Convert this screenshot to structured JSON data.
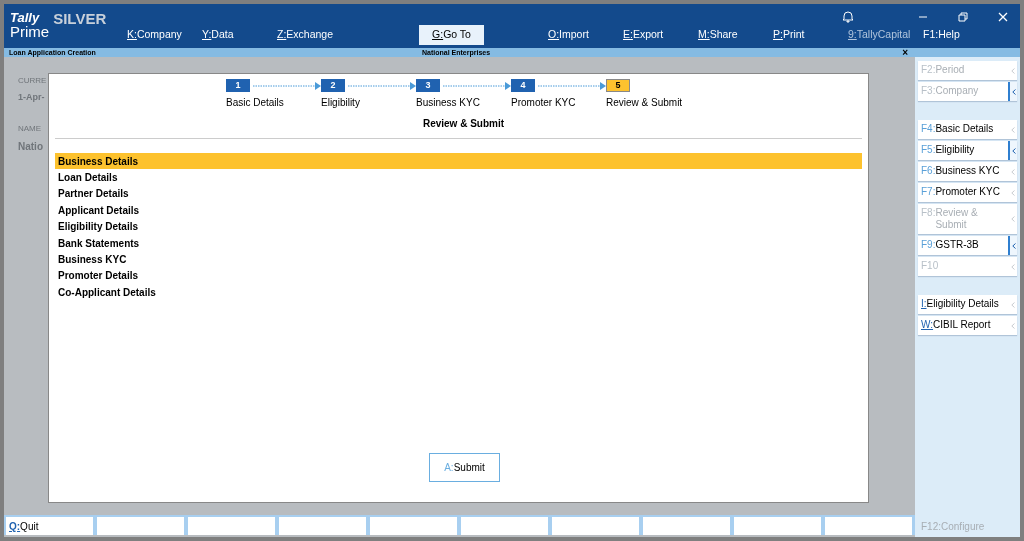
{
  "app": {
    "logo_top": "Tally",
    "logo_bottom": "Prime",
    "edition": "SILVER"
  },
  "top_menu": [
    {
      "key": "K:",
      "label": "Company",
      "selected": false
    },
    {
      "key": "Y:",
      "label": "Data",
      "selected": false
    },
    {
      "key": "Z:",
      "label": "Exchange",
      "selected": false
    },
    {
      "key": "G:",
      "label": "Go To",
      "selected": true
    },
    {
      "key": "O:",
      "label": "Import",
      "selected": false
    },
    {
      "key": "E:",
      "label": "Export",
      "selected": false
    },
    {
      "key": "M:",
      "label": "Share",
      "selected": false
    },
    {
      "key": "P:",
      "label": "Print",
      "selected": false
    },
    {
      "key": "9:",
      "label": "TallyCapital",
      "selected": false,
      "disabled": true
    },
    {
      "key": "F1:",
      "label": "Help",
      "selected": false
    }
  ],
  "subheader": {
    "title": "Loan Application Creation",
    "company": "National Enterprises",
    "close": "×"
  },
  "background_fields": [
    "CURRE",
    "1-Apr-",
    "NAME",
    "Natio"
  ],
  "steps": [
    {
      "number": "1",
      "label": "Basic Details",
      "selected": false
    },
    {
      "number": "2",
      "label": "Eligibility",
      "selected": false
    },
    {
      "number": "3",
      "label": "Business KYC",
      "selected": false
    },
    {
      "number": "4",
      "label": "Promoter KYC",
      "selected": false
    },
    {
      "number": "5",
      "label": "Review & Submit",
      "selected": true
    }
  ],
  "section_title": "Review & Submit",
  "items": [
    {
      "label": "Business Details",
      "selected": true
    },
    {
      "label": "Loan Details",
      "selected": false
    },
    {
      "label": "Partner Details",
      "selected": false
    },
    {
      "label": "Applicant Details",
      "selected": false
    },
    {
      "label": "Eligibility Details",
      "selected": false
    },
    {
      "label": "Bank Statements",
      "selected": false
    },
    {
      "label": "Business KYC",
      "selected": false
    },
    {
      "label": "Promoter Details",
      "selected": false
    },
    {
      "label": "Co-Applicant Details",
      "selected": false
    }
  ],
  "submit_button": {
    "key": "A:",
    "label": "Submit"
  },
  "side_groups": [
    [
      {
        "key": "F2:",
        "label": "Period",
        "disabled": true,
        "highlighted": false
      },
      {
        "key": "F3:",
        "label": "Company",
        "disabled": true,
        "highlighted": true
      }
    ],
    [
      {
        "key": "F4:",
        "label": "Basic Details",
        "disabled": false,
        "highlighted": false
      },
      {
        "key": "F5:",
        "label": "Eligibility",
        "disabled": false,
        "highlighted": true
      },
      {
        "key": "F6:",
        "label": "Business KYC",
        "disabled": false,
        "highlighted": false
      },
      {
        "key": "F7:",
        "label": "Promoter KYC",
        "disabled": false,
        "highlighted": false
      },
      {
        "key": "F8:",
        "label": "Review & Submit",
        "disabled": true,
        "highlighted": false
      },
      {
        "key": "F9:",
        "label": "GSTR-3B",
        "disabled": false,
        "highlighted": true
      },
      {
        "key": "F10",
        "disabled": true,
        "highlighted": false
      }
    ],
    [
      {
        "key": "I:",
        "label": "Eligibility Details",
        "disabled": false,
        "highlighted": false,
        "underline": true
      },
      {
        "key": "W:",
        "label": "CIBIL Report",
        "disabled": false,
        "highlighted": false,
        "underline": true
      }
    ]
  ],
  "bottom_bar": {
    "quit": {
      "key": "Q:",
      "label": "Quit"
    },
    "configure": {
      "key": "F12:",
      "label": "Configure",
      "disabled": true
    }
  }
}
